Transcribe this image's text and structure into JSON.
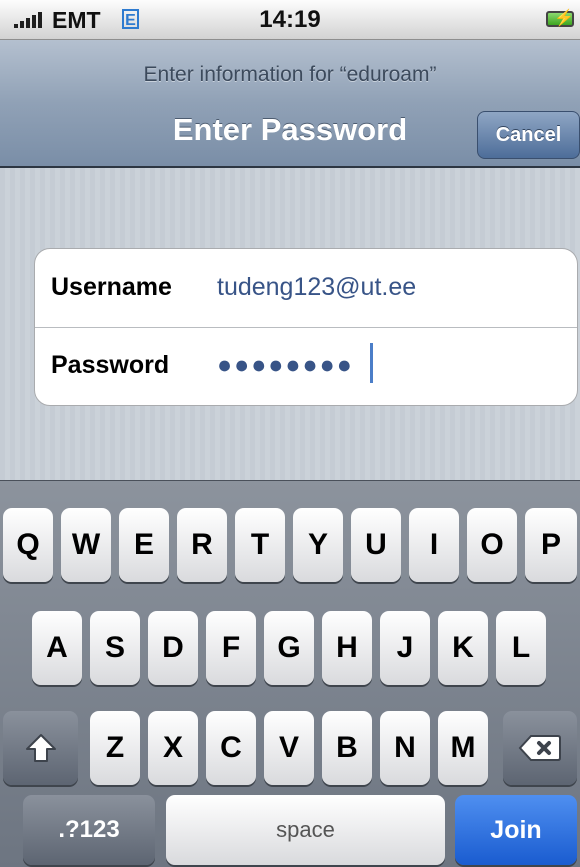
{
  "status_bar": {
    "carrier": "EMT",
    "network_type": "E",
    "time": "14:19",
    "signal_icon": "signal-bars-icon",
    "battery_icon": "battery-charging-icon"
  },
  "nav": {
    "prompt": "Enter information for “eduroam”",
    "title": "Enter Password",
    "cancel_label": "Cancel"
  },
  "form": {
    "username_label": "Username",
    "username_value": "tudeng123@ut.ee",
    "password_label": "Password",
    "password_value": "●●●●●●●●"
  },
  "keyboard": {
    "row1": [
      "Q",
      "W",
      "E",
      "R",
      "T",
      "Y",
      "U",
      "I",
      "O",
      "P"
    ],
    "row2": [
      "A",
      "S",
      "D",
      "F",
      "G",
      "H",
      "J",
      "K",
      "L"
    ],
    "row3": [
      "Z",
      "X",
      "C",
      "V",
      "B",
      "N",
      "M"
    ],
    "shift_icon": "shift-arrow-icon",
    "delete_icon": "backspace-icon",
    "numbers_label": ".?123",
    "space_label": "space",
    "join_label": "Join"
  },
  "colors": {
    "accent_blue": "#1a5cd0",
    "nav_blue": "#7a8ea7",
    "value_text": "#385487"
  }
}
